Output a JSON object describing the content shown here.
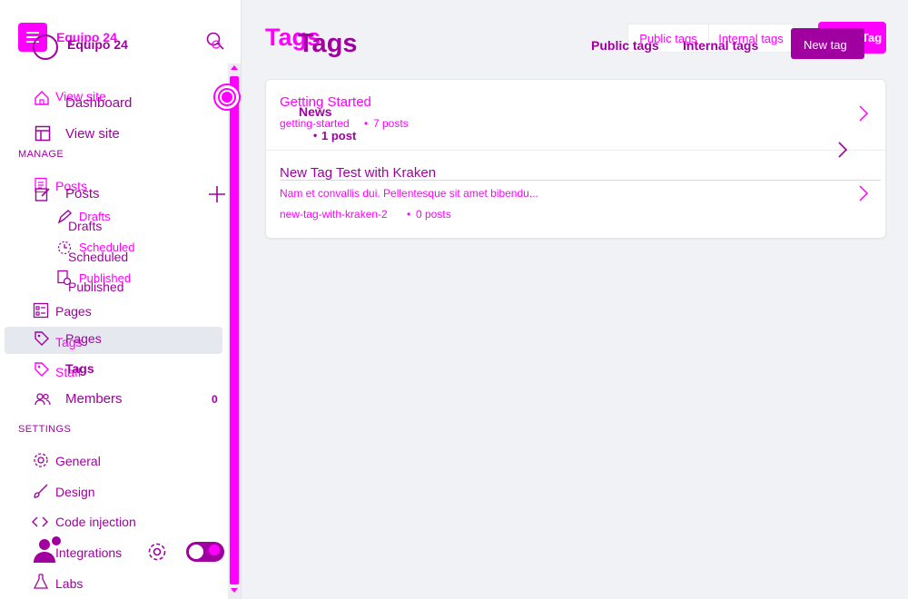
{
  "site": {
    "name": "Equipo 24",
    "name_ghost": "Equipo 24"
  },
  "sidebar": {
    "dashboard": "Dashboard",
    "view_site": "View site",
    "view_site_ghost": "View site",
    "manage_label": "MANAGE",
    "settings_label": "SETTINGS",
    "posts": "Posts",
    "posts_ghost": "Posts",
    "drafts": "Drafts",
    "drafts_ghost": "Drafts",
    "scheduled": "Scheduled",
    "scheduled_ghost": "Scheduled",
    "published": "Published",
    "published_ghost": "Published",
    "pages": "Pages",
    "pages_ghost": "Pages",
    "tags": "Tags",
    "tags_ghost": "Tags",
    "staff": "Staff",
    "members": "Members",
    "members_count": "0",
    "general": "General",
    "design": "Design",
    "code_injection": "Code injection",
    "integrations": "Integrations",
    "labs": "Labs"
  },
  "header": {
    "title": "Tags",
    "title_ghost": "Tags",
    "public_tags": "Public tags",
    "public_tags_ghost": "Public tags",
    "internal_tags": "Internal tags",
    "internal_tags_ghost": "Internal tags",
    "new_tag": "New tag",
    "new_tag_ghost": "Tag"
  },
  "tags": [
    {
      "name": "Getting Started",
      "slug": "getting-started",
      "posts": "7 posts"
    },
    {
      "name": "New Tag Test with Kraken",
      "description": "Nam et convallis dui. Pellentesque sit amet bibendu...",
      "slug": "new-tag-with-kraken-2",
      "posts": "0 posts"
    }
  ],
  "overlay_tag": {
    "name": "News",
    "posts": "1 post"
  },
  "colors": {
    "accent": "#ff00ff",
    "text": "#a000a0",
    "primary_button": "#a000a0"
  }
}
